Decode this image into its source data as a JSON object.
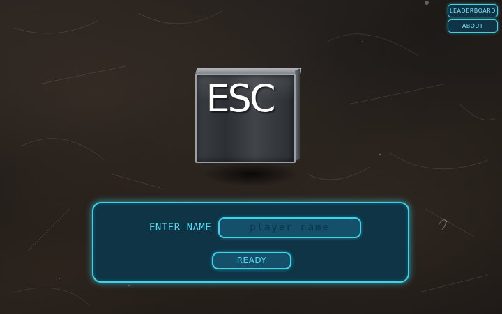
{
  "top_menu": {
    "leaderboard_label": "LEADERBOARD",
    "about_label": "ABOUT"
  },
  "logo": {
    "text": "ESC"
  },
  "name_panel": {
    "enter_label": "ENTER NAME",
    "name_placeholder": "player name",
    "name_value": "",
    "ready_label": "READY"
  },
  "colors": {
    "accent": "#3fd3ea",
    "panel_bg": "#0e3446",
    "field_bg": "#14506a",
    "text_accent": "#52dcf0",
    "background": "#221d1a"
  }
}
